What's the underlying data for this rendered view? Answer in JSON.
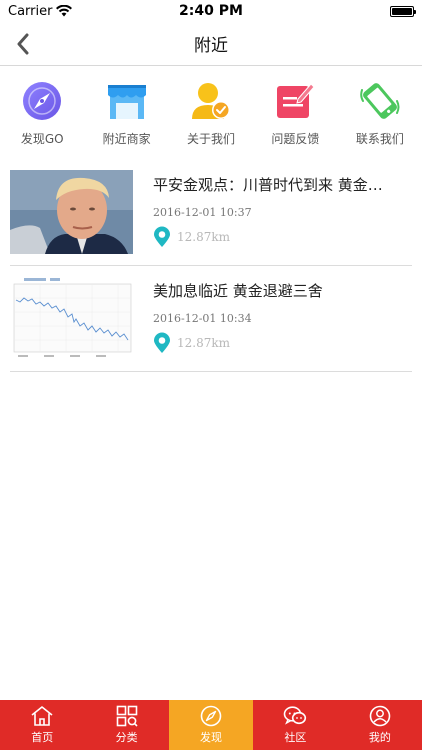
{
  "status_bar": {
    "carrier": "Carrier",
    "time": "2:40 PM",
    "battery_level": 1.0
  },
  "nav": {
    "title": "附近",
    "back_icon": "chevron-left-icon"
  },
  "quick_actions": [
    {
      "label": "发现GO",
      "icon": "compass-icon",
      "color": "#7b6cf0"
    },
    {
      "label": "附近商家",
      "icon": "store-icon",
      "color": "#2f9ef0"
    },
    {
      "label": "关于我们",
      "icon": "user-check-icon",
      "color": "#f5b916"
    },
    {
      "label": "问题反馈",
      "icon": "edit-icon",
      "color": "#ef4565"
    },
    {
      "label": "联系我们",
      "icon": "phone-icon",
      "color": "#4cc75d"
    }
  ],
  "news": [
    {
      "title": "平安金观点：川普时代到来 黄金…",
      "date": "2016-12-01 10:37",
      "distance": "12.87km",
      "thumb": "portrait-photo"
    },
    {
      "title": "美加息临近 黄金退避三舍",
      "date": "2016-12-01 10:34",
      "distance": "12.87km",
      "thumb": "line-chart-thumbnail"
    }
  ],
  "tabs": [
    {
      "label": "首页",
      "icon": "home-icon",
      "active": false
    },
    {
      "label": "分类",
      "icon": "category-grid-icon",
      "active": false
    },
    {
      "label": "发现",
      "icon": "compass-icon",
      "active": true
    },
    {
      "label": "社区",
      "icon": "chat-icon",
      "active": false
    },
    {
      "label": "我的",
      "icon": "profile-icon",
      "active": false
    }
  ],
  "colors": {
    "tab_bar": "#e02b27",
    "tab_active": "#f5a623",
    "location_pin": "#1fb8c3"
  }
}
